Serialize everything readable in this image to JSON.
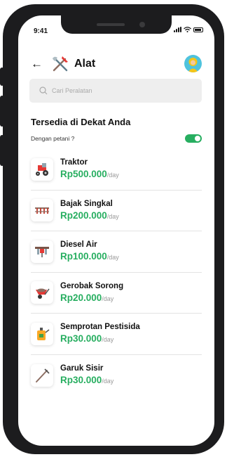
{
  "status_bar": {
    "time": "9:41"
  },
  "header": {
    "title": "Alat"
  },
  "search": {
    "placeholder": "Cari Peralatan"
  },
  "section": {
    "title": "Tersedia di Dekat Anda",
    "toggle_label": "Dengan petani ?"
  },
  "colors": {
    "accent": "#27ae60",
    "avatar_bg": "#4fc3dd"
  },
  "items": [
    {
      "name": "Traktor",
      "price": "Rp500.000",
      "unit": "/day",
      "icon": "tractor-icon"
    },
    {
      "name": "Bajak Singkal",
      "price": "Rp200.000",
      "unit": "/day",
      "icon": "plow-icon"
    },
    {
      "name": "Diesel Air",
      "price": "Rp100.000",
      "unit": "/day",
      "icon": "diesel-pump-icon"
    },
    {
      "name": "Gerobak Sorong",
      "price": "Rp20.000",
      "unit": "/day",
      "icon": "wheelbarrow-icon"
    },
    {
      "name": "Semprotan Pestisida",
      "price": "Rp30.000",
      "unit": "/day",
      "icon": "sprayer-icon"
    },
    {
      "name": "Garuk Sisir",
      "price": "Rp30.000",
      "unit": "/day",
      "icon": "rake-icon"
    }
  ]
}
